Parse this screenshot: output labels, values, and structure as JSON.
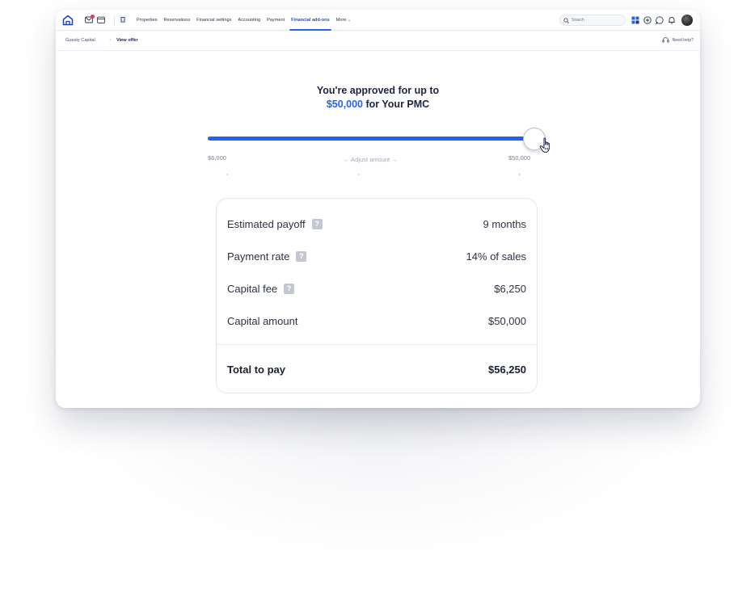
{
  "nav": {
    "links": [
      "Properties",
      "Reservations",
      "Financial settings",
      "Accounting",
      "Payment",
      "Financial add-ons",
      "More"
    ],
    "active": "Financial add-ons",
    "search_placeholder": "Search"
  },
  "breadcrumb": {
    "parent": "Guesty Capital",
    "current": "View offer",
    "help": "Need help?"
  },
  "offer": {
    "heading_line1": "You're approved for up to",
    "amount": "$50,000",
    "heading_line2_suffix": " for Your PMC",
    "slider_min": "$6,000",
    "slider_max": "$50,000",
    "slider_hint": "← Adjust amount →",
    "slider_value_fraction": 1.0
  },
  "summary": {
    "rows": [
      {
        "label": "Estimated payoff",
        "value": "9 months",
        "help": "?"
      },
      {
        "label": "Payment rate",
        "value": "14% of sales",
        "help": "?"
      },
      {
        "label": "Capital fee",
        "value": "$6,250",
        "help": "?"
      },
      {
        "label": "Capital amount",
        "value": "$50,000"
      }
    ],
    "total_label": "Total to pay",
    "total_value": "$56,250"
  },
  "colors": {
    "accent": "#2564e8",
    "heading": "#1d2440",
    "notification": "#e53854"
  }
}
